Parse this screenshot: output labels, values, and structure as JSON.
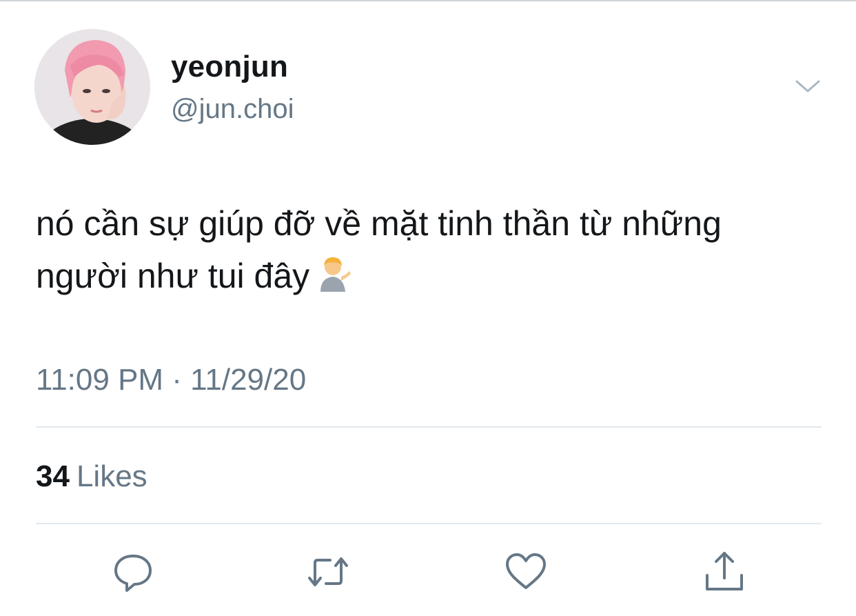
{
  "author": {
    "display_name": "yeonjun",
    "handle": "@jun.choi"
  },
  "tweet": {
    "text": "nó cần sự giúp đỡ về mặt tinh thần từ những người như tui đây",
    "emoji": "person-tipping-hand"
  },
  "meta": {
    "timestamp": "11:09 PM · 11/29/20"
  },
  "stats": {
    "likes_count": "34",
    "likes_label": "Likes"
  },
  "actions": [
    {
      "name": "reply",
      "icon": "speech-bubble-icon"
    },
    {
      "name": "retweet",
      "icon": "retweet-icon"
    },
    {
      "name": "like",
      "icon": "heart-icon"
    },
    {
      "name": "share",
      "icon": "share-icon"
    }
  ],
  "colors": {
    "primary_text": "#14171a",
    "secondary_text": "#657786",
    "divider": "#e1e8ed",
    "icon": "#657786"
  }
}
